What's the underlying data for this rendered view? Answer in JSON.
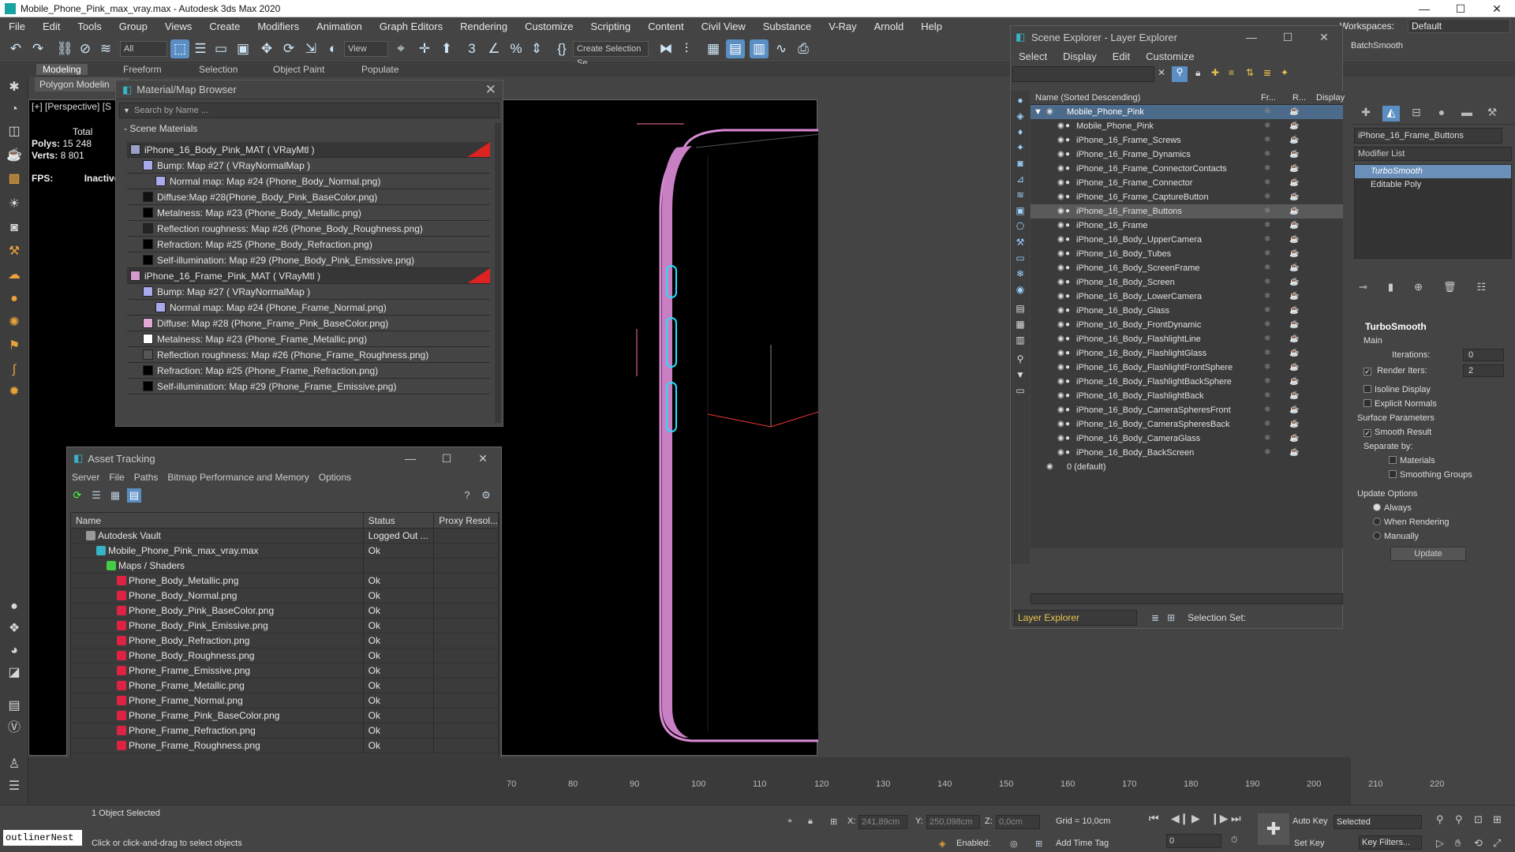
{
  "window": {
    "title": "Mobile_Phone_Pink_max_vray.max - Autodesk 3ds Max 2020",
    "min": "—",
    "max": "☐",
    "close": "✕"
  },
  "menu": [
    "File",
    "Edit",
    "Tools",
    "Group",
    "Views",
    "Create",
    "Modifiers",
    "Animation",
    "Graph Editors",
    "Rendering",
    "Customize",
    "Scripting",
    "Content",
    "Civil View",
    "Substance",
    "V-Ray",
    "Arnold",
    "Help"
  ],
  "workspace": {
    "label": "Workspaces:",
    "value": "Default"
  },
  "toolbar": {
    "filter": "All",
    "view": "View",
    "selection_set": "Create Selection Se"
  },
  "ribbon": {
    "tabs": [
      "Modeling",
      "Freeform",
      "Selection",
      "Object Paint",
      "Populate"
    ],
    "sub": "Polygon Modelin"
  },
  "viewport": {
    "label": "[+] [Perspective] [S",
    "stats_total": "Total",
    "polys_label": "Polys:",
    "polys": "15 248",
    "verts_label": "Verts:",
    "verts": "8 801",
    "fps_label": "FPS:",
    "fps": "Inactive"
  },
  "mmb": {
    "title": "Material/Map Browser",
    "search": "Search by Name ...",
    "section": "- Scene Materials",
    "rows": [
      {
        "text": "iPhone_16_Body_Pink_MAT  ( VRayMtl )",
        "level": 0,
        "color": "#9aa0c8"
      },
      {
        "text": "Bump: Map #27  ( VRayNormalMap )",
        "level": 1,
        "color": "#a9a9ee"
      },
      {
        "text": "Normal map: Map #24 (Phone_Body_Normal.png)",
        "level": 2,
        "color": "#a9a9ee"
      },
      {
        "text": "Diffuse:Map #28(Phone_Body_Pink_BaseColor.png)",
        "level": 1,
        "color": "#111111"
      },
      {
        "text": "Metalness: Map #23 (Phone_Body_Metallic.png)",
        "level": 1,
        "color": "#000000"
      },
      {
        "text": "Reflection roughness: Map #26 (Phone_Body_Roughness.png)",
        "level": 1,
        "color": "#222222"
      },
      {
        "text": "Refraction: Map #25 (Phone_Body_Refraction.png)",
        "level": 1,
        "color": "#000000"
      },
      {
        "text": "Self-illumination: Map #29 (Phone_Body_Pink_Emissive.png)",
        "level": 1,
        "color": "#000000"
      },
      {
        "text": "iPhone_16_Frame_Pink_MAT  ( VRayMtl )",
        "level": 0,
        "color": "#d49bd0"
      },
      {
        "text": "Bump: Map #27  ( VRayNormalMap )",
        "level": 1,
        "color": "#a9a9ee"
      },
      {
        "text": "Normal map: Map #24 (Phone_Frame_Normal.png)",
        "level": 2,
        "color": "#a9a9ee"
      },
      {
        "text": "Diffuse: Map #28 (Phone_Frame_Pink_BaseColor.png)",
        "level": 1,
        "color": "#e3a7d6"
      },
      {
        "text": "Metalness: Map #23 (Phone_Frame_Metallic.png)",
        "level": 1,
        "color": "#ffffff"
      },
      {
        "text": "Reflection roughness: Map #26 (Phone_Frame_Roughness.png)",
        "level": 1,
        "color": "#555555"
      },
      {
        "text": "Refraction: Map #25 (Phone_Frame_Refraction.png)",
        "level": 1,
        "color": "#000000"
      },
      {
        "text": "Self-illumination: Map #29 (Phone_Frame_Emissive.png)",
        "level": 1,
        "color": "#000000"
      }
    ]
  },
  "asset_tracking": {
    "title": "Asset Tracking",
    "menu": [
      "Server",
      "File",
      "Paths",
      "Bitmap Performance and Memory",
      "Options"
    ],
    "headers": [
      "Name",
      "Status",
      "Proxy Resol..."
    ],
    "rows": [
      {
        "name": "Autodesk Vault",
        "status": "Logged Out ...",
        "level": 1,
        "icon": "vault"
      },
      {
        "name": "Mobile_Phone_Pink_max_vray.max",
        "status": "Ok",
        "level": 2,
        "icon": "max"
      },
      {
        "name": "Maps / Shaders",
        "status": "",
        "level": 3,
        "icon": "folder"
      },
      {
        "name": "Phone_Body_Metallic.png",
        "status": "Ok",
        "level": 4,
        "icon": "png"
      },
      {
        "name": "Phone_Body_Normal.png",
        "status": "Ok",
        "level": 4,
        "icon": "png"
      },
      {
        "name": "Phone_Body_Pink_BaseColor.png",
        "status": "Ok",
        "level": 4,
        "icon": "png"
      },
      {
        "name": "Phone_Body_Pink_Emissive.png",
        "status": "Ok",
        "level": 4,
        "icon": "png"
      },
      {
        "name": "Phone_Body_Refraction.png",
        "status": "Ok",
        "level": 4,
        "icon": "png"
      },
      {
        "name": "Phone_Body_Roughness.png",
        "status": "Ok",
        "level": 4,
        "icon": "png"
      },
      {
        "name": "Phone_Frame_Emissive.png",
        "status": "Ok",
        "level": 4,
        "icon": "png"
      },
      {
        "name": "Phone_Frame_Metallic.png",
        "status": "Ok",
        "level": 4,
        "icon": "png"
      },
      {
        "name": "Phone_Frame_Normal.png",
        "status": "Ok",
        "level": 4,
        "icon": "png"
      },
      {
        "name": "Phone_Frame_Pink_BaseColor.png",
        "status": "Ok",
        "level": 4,
        "icon": "png"
      },
      {
        "name": "Phone_Frame_Refraction.png",
        "status": "Ok",
        "level": 4,
        "icon": "png"
      },
      {
        "name": "Phone_Frame_Roughness.png",
        "status": "Ok",
        "level": 4,
        "icon": "png"
      }
    ]
  },
  "scene_explorer": {
    "title": "Scene Explorer - Layer Explorer",
    "menu": [
      "Select",
      "Display",
      "Edit",
      "Customize"
    ],
    "headers": [
      "Name (Sorted Descending)",
      "Fr...",
      "R...",
      "Display a"
    ],
    "root": "Mobile_Phone_Pink",
    "items": [
      "Mobile_Phone_Pink",
      "iPhone_16_Frame_Screws",
      "iPhone_16_Frame_Dynamics",
      "iPhone_16_Frame_ConnectorContacts",
      "iPhone_16_Frame_Connector",
      "iPhone_16_Frame_CaptureButton",
      "iPhone_16_Frame_Buttons",
      "iPhone_16_Frame",
      "iPhone_16_Body_UpperCamera",
      "iPhone_16_Body_Tubes",
      "iPhone_16_Body_ScreenFrame",
      "iPhone_16_Body_Screen",
      "iPhone_16_Body_LowerCamera",
      "iPhone_16_Body_Glass",
      "iPhone_16_Body_FrontDynamic",
      "iPhone_16_Body_FlashlightLine",
      "iPhone_16_Body_FlashlightGlass",
      "iPhone_16_Body_FlashlightFrontSphere",
      "iPhone_16_Body_FlashlightBackSphere",
      "iPhone_16_Body_FlashlightBack",
      "iPhone_16_Body_CameraSpheresFront",
      "iPhone_16_Body_CameraSpheresBack",
      "iPhone_16_Body_CameraGlass",
      "iPhone_16_Body_BackScreen"
    ],
    "default_layer": "0 (default)",
    "selected": "iPhone_16_Frame_Buttons",
    "footer_dd": "Layer Explorer",
    "footer_sel": "Selection Set:"
  },
  "command_panel": {
    "batch": "BatchSmooth",
    "object_name": "iPhone_16_Frame_Buttons",
    "modifier_list": "Modifier List",
    "stack": [
      "TurboSmooth",
      "Editable Poly"
    ],
    "rollout_title": "TurboSmooth",
    "main": "Main",
    "iterations_label": "Iterations:",
    "iterations": "0",
    "render_iters_label": "Render Iters:",
    "render_iters": "2",
    "isoline": "Isoline Display",
    "explicit": "Explicit Normals",
    "surface": "Surface Parameters",
    "smooth": "Smooth Result",
    "separate": "Separate by:",
    "materials": "Materials",
    "smoothing": "Smoothing Groups",
    "update_options": "Update Options",
    "always": "Always",
    "when_rendering": "When Rendering",
    "manually": "Manually",
    "update": "Update"
  },
  "timeline": {
    "ticks": [
      "70",
      "80",
      "90",
      "100",
      "110",
      "120",
      "130",
      "140",
      "150",
      "160",
      "170",
      "180",
      "190",
      "200",
      "210",
      "220"
    ]
  },
  "status": {
    "selected": "1 Object Selected",
    "hint": "Click or click-and-drag to select objects",
    "outliner": "outlinerNest",
    "x_label": "X:",
    "x": "241,89cm",
    "y_label": "Y:",
    "y": "250,098cm",
    "z_label": "Z:",
    "z": "0,0cm",
    "grid": "Grid = 10,0cm",
    "enabled": "Enabled:",
    "add_time_tag": "Add Time Tag",
    "auto_key": "Auto Key",
    "set_key": "Set Key",
    "selected_dd": "Selected",
    "key_filters": "Key Filters...",
    "frame": "0"
  }
}
